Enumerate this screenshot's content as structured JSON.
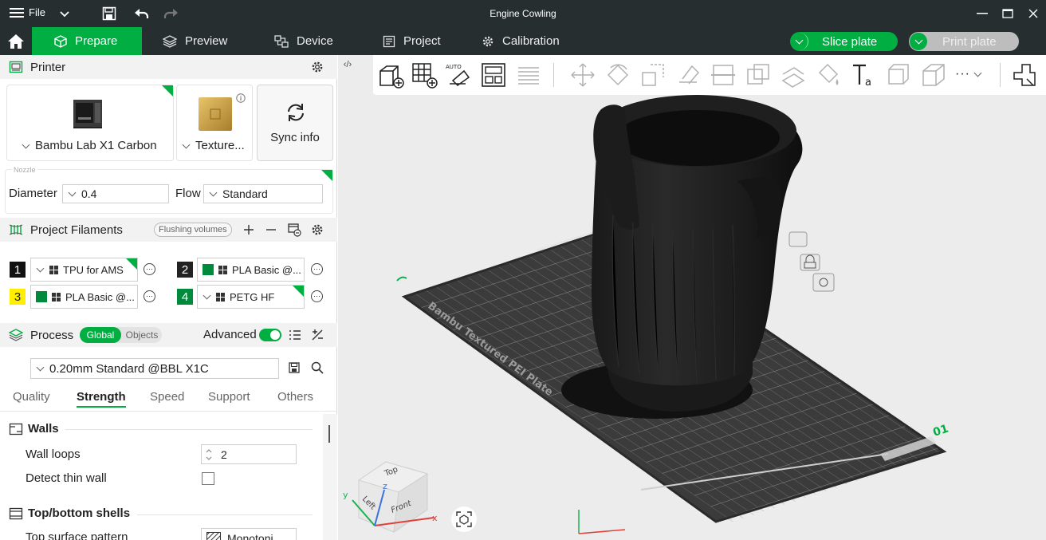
{
  "titlebar": {
    "file_label": "File",
    "document_title": "Engine Cowling"
  },
  "tabs": [
    {
      "label": "Prepare"
    },
    {
      "label": "Preview"
    },
    {
      "label": "Device"
    },
    {
      "label": "Project"
    },
    {
      "label": "Calibration"
    }
  ],
  "actions": {
    "slice_label": "Slice plate",
    "print_label": "Print plate"
  },
  "printer": {
    "section_title": "Printer",
    "printer_name": "Bambu Lab X1 Carbon",
    "plate_name": "Texture...",
    "sync_label": "Sync info",
    "nozzle_caption": "Nozzle",
    "diameter_label": "Diameter",
    "diameter_value": "0.4",
    "flow_label": "Flow",
    "flow_value": "Standard"
  },
  "filaments": {
    "section_title": "Project Filaments",
    "flushing_label": "Flushing volumes",
    "items": [
      {
        "index": "1",
        "name": "TPU for AMS",
        "index_color": "#111111",
        "index_text_color": "#ffffff",
        "swatch": "#ffffff"
      },
      {
        "index": "2",
        "name": "PLA Basic @...",
        "index_color": "#222222",
        "index_text_color": "#ffffff",
        "swatch": "#008a3c"
      },
      {
        "index": "3",
        "name": "PLA Basic @...",
        "index_color": "#ffee00",
        "index_text_color": "#222222",
        "swatch": "#008a3c"
      },
      {
        "index": "4",
        "name": "PETG HF",
        "index_color": "#008a3c",
        "index_text_color": "#ffffff",
        "swatch": "#ffffff"
      }
    ]
  },
  "process": {
    "section_title": "Process",
    "global_label": "Global",
    "objects_label": "Objects",
    "advanced_label": "Advanced",
    "advanced_on": true,
    "preset": "0.20mm Standard @BBL X1C",
    "subtabs": [
      "Quality",
      "Strength",
      "Speed",
      "Support",
      "Others"
    ],
    "active_subtab": "Strength",
    "walls_title": "Walls",
    "wall_loops_label": "Wall loops",
    "wall_loops_value": "2",
    "detect_thin_wall_label": "Detect thin wall",
    "detect_thin_wall_checked": false,
    "top_bottom_title": "Top/bottom shells",
    "top_surface_pattern_label": "Top surface pattern",
    "top_surface_pattern_value": "Monotoni"
  },
  "viewport": {
    "plate_text": "Bambu Textured PEI Plate",
    "plate_number": "01",
    "cube_labels": {
      "top": "Top",
      "left": "Left",
      "front": "Front"
    },
    "axis_labels": {
      "x": "x",
      "y": "y",
      "z": "z"
    }
  },
  "colors": {
    "accent": "#00ae42",
    "titlebar_bg": "#262e30",
    "panel_header_bg": "#f2f2f2",
    "viewport_bg": "#ececec"
  }
}
